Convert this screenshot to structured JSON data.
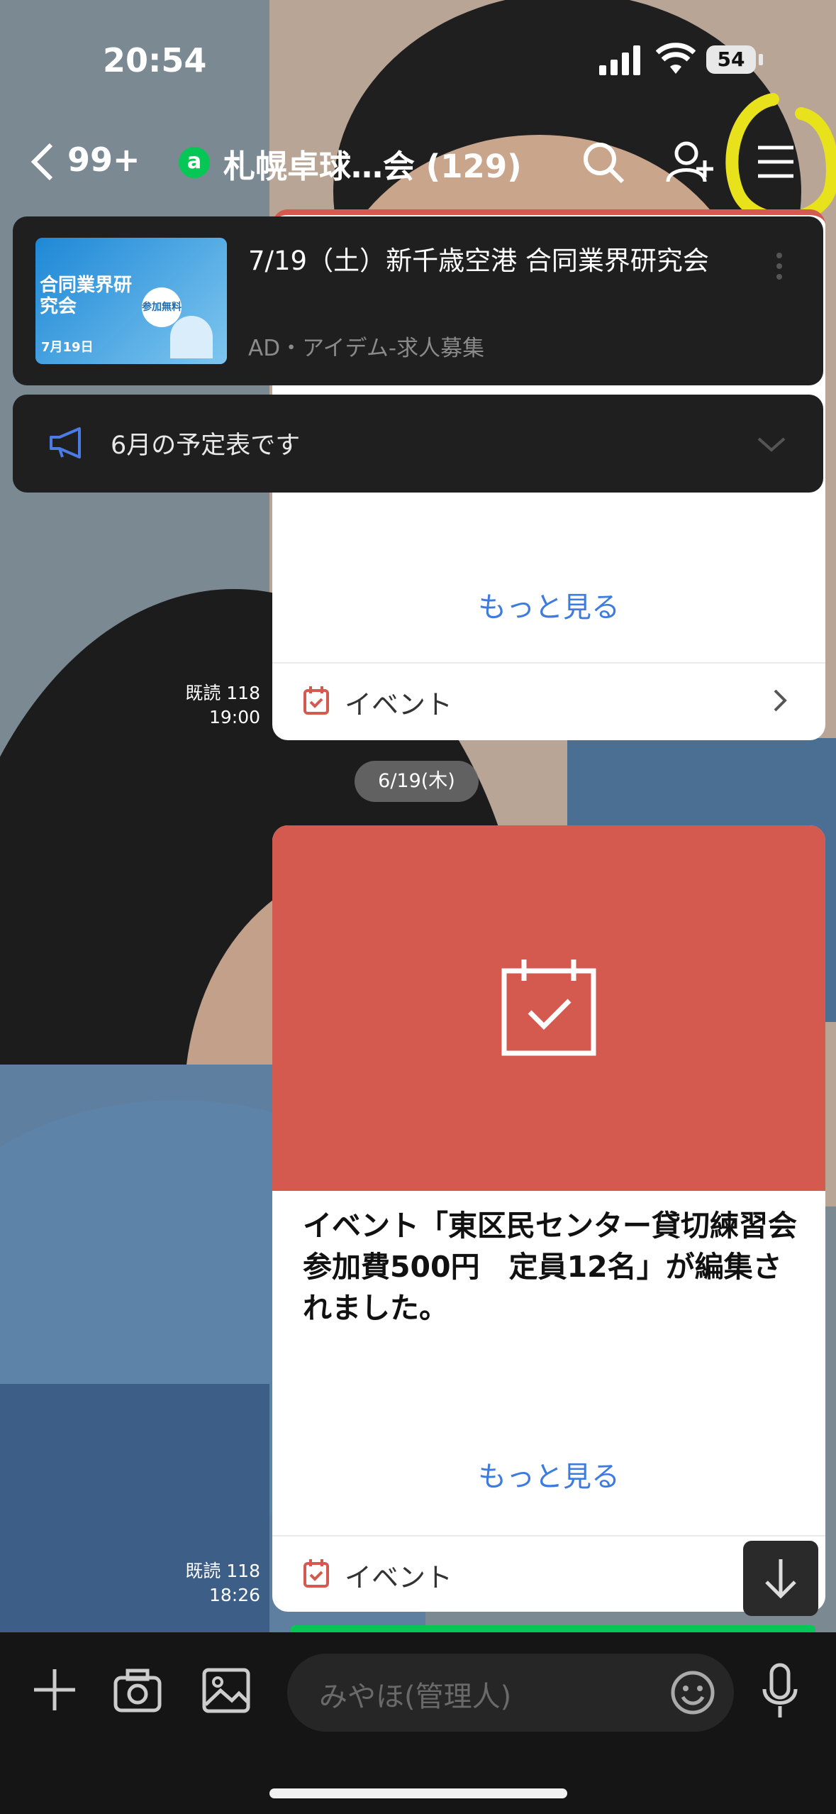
{
  "status_bar": {
    "time": "20:54",
    "battery": "54"
  },
  "header": {
    "back_count": "99+",
    "group_initial": "a",
    "title": "札幌卓球…会 (129)"
  },
  "ad": {
    "title": "7/19（土）新千歳空港 合同業界研究会",
    "sub": "AD・アイデム-求人募集",
    "thumb_texts": {
      "headline": "合同業界研究会",
      "badge": "参加無料",
      "date": "7月19日"
    }
  },
  "notice": {
    "text": "6月の予定表です"
  },
  "card1": {
    "more": "もっと見る",
    "footer": "イベント",
    "read": "既読 118",
    "time": "19:00"
  },
  "date_divider": "6/19(木)",
  "card2": {
    "body": "イベント「東区民センター貸切練習会　参加費500円　定員12名」が編集されました。",
    "more": "もっと見る",
    "footer": "イベント",
    "read": "既読 118",
    "time": "18:26"
  },
  "input": {
    "placeholder": "みやほ(管理人)"
  },
  "colors": {
    "event_red": "#d45a4f",
    "link_blue": "#3e7be0",
    "highlight": "#e7e21c",
    "line_green": "#06c755"
  }
}
